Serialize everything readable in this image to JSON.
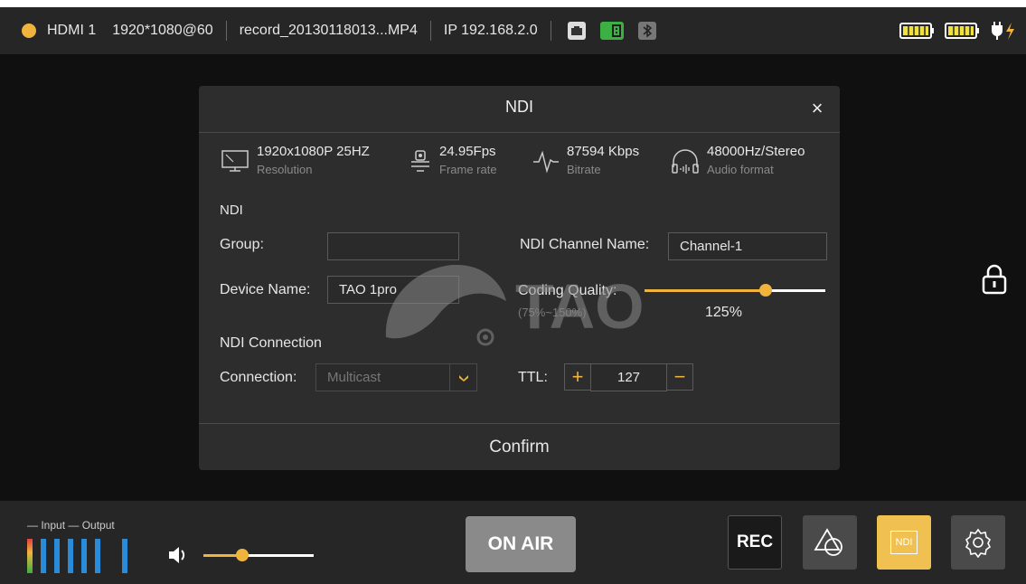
{
  "status": {
    "input": "HDMI 1",
    "signal": "1920*1080@60",
    "file": "record_20130118013...MP4",
    "ip": "IP 192.168.2.0"
  },
  "dialog": {
    "title": "NDI",
    "close": "×",
    "stats": [
      {
        "value": "1920x1080P 25HZ",
        "label": "Resolution"
      },
      {
        "value": "24.95Fps",
        "label": "Frame rate"
      },
      {
        "value": "87594 Kbps",
        "label": "Bitrate"
      },
      {
        "value": "48000Hz/Stereo",
        "label": "Audio format"
      }
    ],
    "section_ndi": "NDI",
    "group_label": "Group:",
    "group_value": "",
    "channel_label": "NDI Channel Name:",
    "channel_value": "Channel-1",
    "device_label": "Device Name:",
    "device_value": "TAO 1pro",
    "quality_label": "Coding Quality:",
    "quality_range": "(75%~150%)",
    "quality_value": "125%",
    "quality_fraction": 0.67,
    "section_connection": "NDI Connection",
    "connection_label": "Connection:",
    "connection_value": "Multicast",
    "ttl_label": "TTL:",
    "ttl_plus": "+",
    "ttl_value": "127",
    "ttl_minus": "−",
    "confirm": "Confirm",
    "watermark": "TAO"
  },
  "bottom": {
    "input_label": "Input",
    "output_label": "Output",
    "volume_fraction": 0.35,
    "onair": "ON AIR",
    "rec": "REC",
    "ndi": "NDI"
  },
  "colors": {
    "accent": "#f0b43c",
    "meter": "#2a8bd8",
    "battery": "#f0e040",
    "ethernet": "#e0e0e0",
    "sd": "#3cb043"
  }
}
